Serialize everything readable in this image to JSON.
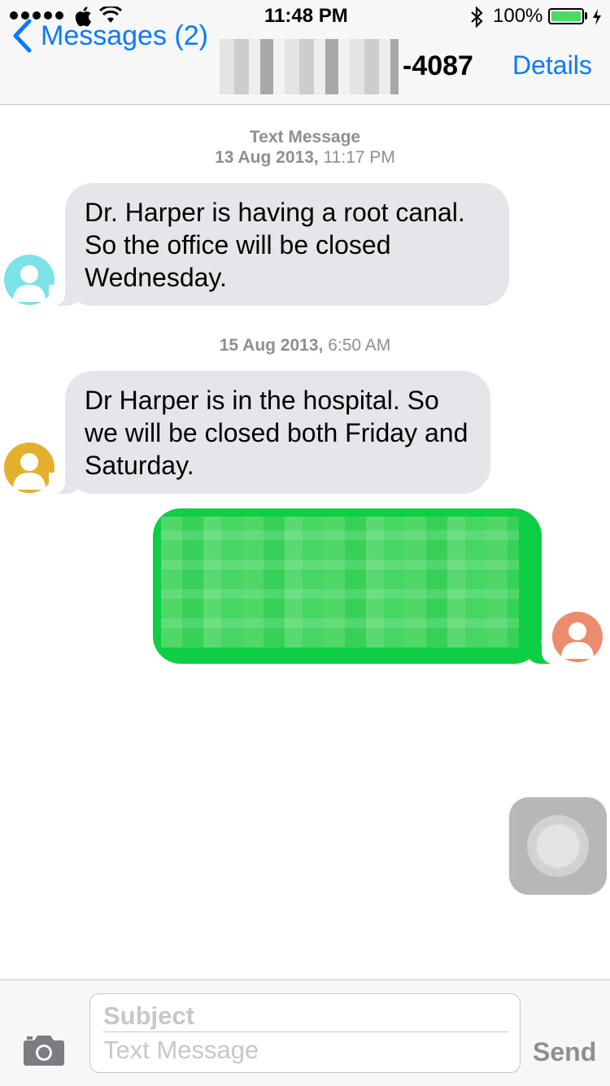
{
  "status_bar": {
    "time": "11:48 PM",
    "battery": "100%",
    "icons": [
      "signal-dots-icon",
      "apple-icon",
      "wifi-icon",
      "bluetooth-icon",
      "battery-icon",
      "charging-icon"
    ]
  },
  "nav": {
    "back_label": "Messages (2)",
    "title_suffix": "-4087",
    "details_label": "Details"
  },
  "conversation": {
    "header_label": "Text Message",
    "timestamps": [
      {
        "date": "13 Aug 2013,",
        "time": " 11:17 PM"
      },
      {
        "date": "15 Aug 2013,",
        "time": " 6:50 AM"
      }
    ],
    "messages": [
      {
        "direction": "incoming",
        "text": "Dr. Harper is having a root canal. So the office will be closed Wednesday.",
        "avatar_color": "#7de3e6"
      },
      {
        "direction": "incoming",
        "text": "Dr Harper is in the hospital. So we will be closed both Friday and Saturday.",
        "avatar_color": "#e3b02d"
      },
      {
        "direction": "outgoing",
        "text": "",
        "avatar_color": "#ec8c6e",
        "bubble_color": "#0ece45"
      }
    ]
  },
  "input": {
    "subject_placeholder": "Subject",
    "text_placeholder": "Text Message",
    "send_label": "Send"
  },
  "colors": {
    "accent": "#0a7aff",
    "incoming_bubble": "#e5e5ea",
    "outgoing_bubble": "#0ece45"
  }
}
